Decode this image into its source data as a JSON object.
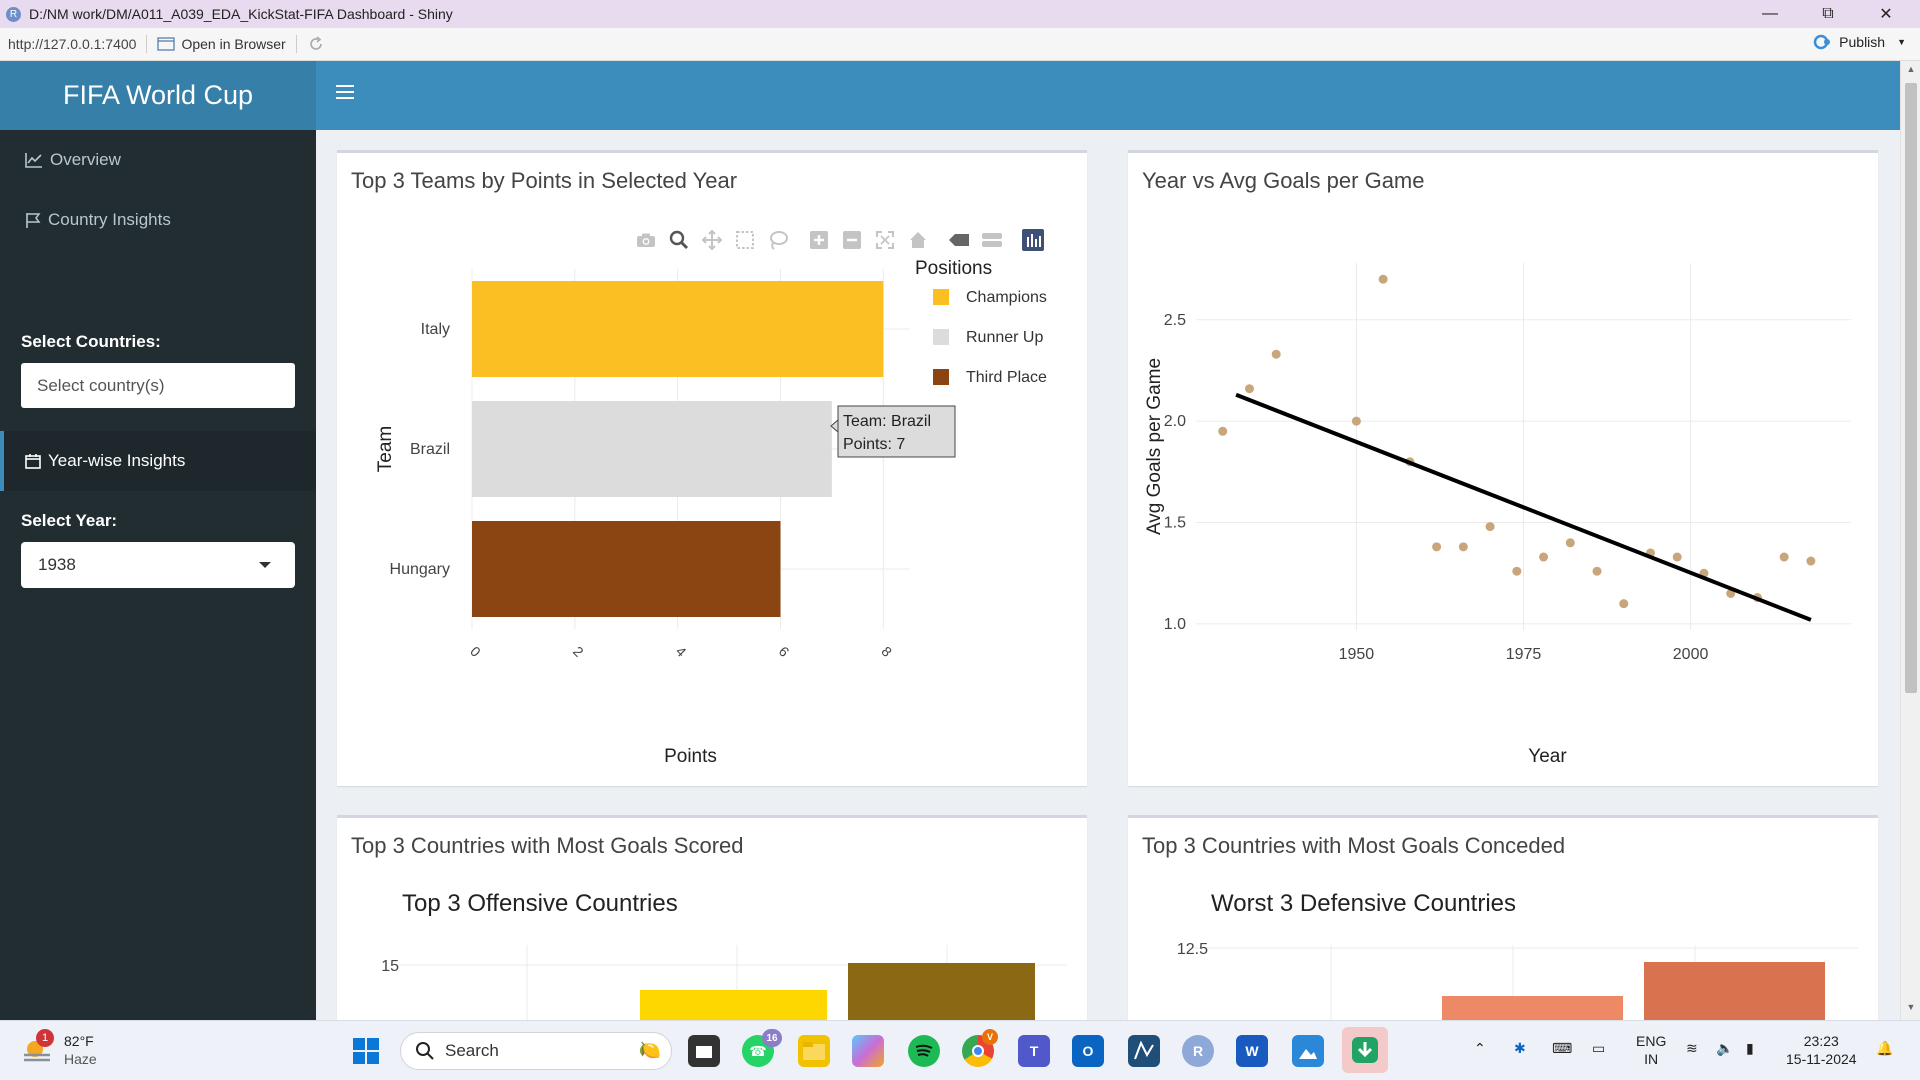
{
  "window": {
    "title": "D:/NM work/DM/A011_A039_EDA_KickStat-FIFA Dashboard - Shiny",
    "app_badge": "R"
  },
  "viewer": {
    "url": "http://127.0.0.1:7400",
    "open_in_browser": "Open in Browser",
    "publish": "Publish"
  },
  "header": {
    "title": "FIFA World Cup"
  },
  "sidebar": {
    "items": [
      {
        "label": "Overview",
        "icon": "line-chart-icon"
      },
      {
        "label": "Country Insights",
        "icon": "flag-icon"
      },
      {
        "label": "Year-wise Insights",
        "icon": "calendar-icon",
        "active": true
      }
    ],
    "countries_label": "Select Countries:",
    "countries_placeholder": "Select country(s)",
    "year_label": "Select Year:",
    "year_value": "1938"
  },
  "boxes": {
    "top_teams_title": "Top 3 Teams by Points in Selected Year",
    "avg_goals_title": "Year vs Avg Goals per Game",
    "most_scored_title": "Top 3 Countries with Most Goals Scored",
    "most_conceded_title": "Top 3 Countries with Most Goals Conceded"
  },
  "chart_data": [
    {
      "type": "bar",
      "orientation": "horizontal",
      "categories": [
        "Italy",
        "Brazil",
        "Hungary"
      ],
      "values": [
        8,
        7,
        6
      ],
      "colors": [
        "#fbbf24",
        "#dcdcdc",
        "#8b4513"
      ],
      "xlabel": "Points",
      "ylabel": "Team",
      "xticks": [
        "0",
        "2",
        "4",
        "6",
        "8"
      ],
      "xlim": [
        0,
        8.5
      ],
      "legend": {
        "title": "Positions",
        "placement": "right",
        "entries": [
          {
            "name": "Champions",
            "color": "#fbbf24"
          },
          {
            "name": "Runner Up",
            "color": "#dcdcdc"
          },
          {
            "name": "Third Place",
            "color": "#8b4513"
          }
        ]
      },
      "tooltip": {
        "line1": "Team:  Brazil",
        "line2": "Points:  7"
      }
    },
    {
      "type": "scatter",
      "xlabel": "Year",
      "ylabel": "Avg Goals per Game",
      "xticks": [
        "1950",
        "1975",
        "2000"
      ],
      "yticks": [
        "1.0",
        "1.5",
        "2.0",
        "2.5"
      ],
      "xlim": [
        1926,
        2024
      ],
      "ylim": [
        0.97,
        2.78
      ],
      "point_color": "#c9a57b",
      "x": [
        1930,
        1934,
        1938,
        1950,
        1954,
        1958,
        1962,
        1966,
        1970,
        1974,
        1978,
        1982,
        1986,
        1990,
        1994,
        1998,
        2002,
        2006,
        2010,
        2014,
        2018
      ],
      "y": [
        1.95,
        2.16,
        2.33,
        2.0,
        2.7,
        1.8,
        1.38,
        1.38,
        1.48,
        1.26,
        1.33,
        1.4,
        1.26,
        1.1,
        1.35,
        1.33,
        1.25,
        1.15,
        1.13,
        1.33,
        1.31
      ],
      "trendline": {
        "x": [
          1932,
          2018
        ],
        "y": [
          2.13,
          1.02
        ],
        "color": "#000000"
      }
    },
    {
      "type": "bar",
      "title": "Top 3 Offensive Countries",
      "yticks": [
        "15"
      ],
      "colors": [
        "#ffd700",
        "#8b6914"
      ]
    },
    {
      "type": "bar",
      "title": "Worst 3 Defensive Countries",
      "yticks": [
        "12.5"
      ],
      "colors": [
        "#ee8966",
        "#d9734f"
      ]
    }
  ],
  "taskbar": {
    "weather_temp": "82°F",
    "weather_desc": "Haze",
    "weather_badge": "1",
    "search": "Search",
    "whatsapp_badge": "16",
    "chrome_badge": "V",
    "lang_line1": "ENG",
    "lang_line2": "IN",
    "time": "23:23",
    "date": "15-11-2024"
  }
}
